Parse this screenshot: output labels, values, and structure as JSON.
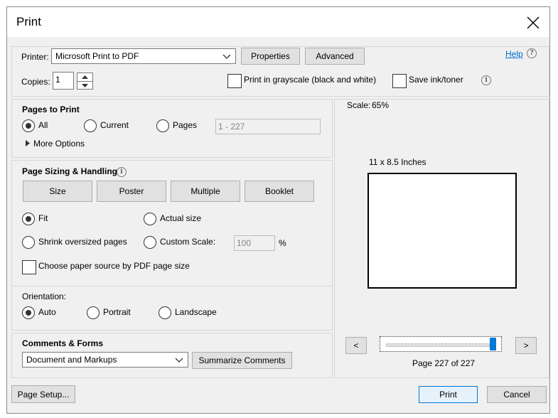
{
  "dialog": {
    "title": "Print",
    "close_icon": "close-icon"
  },
  "printer": {
    "label": "Printer:",
    "selected": "Microsoft Print to PDF",
    "properties_label": "Properties",
    "advanced_label": "Advanced",
    "help_label": "Help"
  },
  "copies": {
    "label": "Copies:",
    "value": "1"
  },
  "options": {
    "grayscale_label": "Print in grayscale (black and white)",
    "save_ink_label": "Save ink/toner"
  },
  "pages_to_print": {
    "heading": "Pages to Print",
    "all_label": "All",
    "current_label": "Current",
    "pages_label": "Pages",
    "pages_range_value": "1 - 227",
    "more_options_label": "More Options",
    "selected": "All"
  },
  "page_sizing": {
    "heading": "Page Sizing & Handling",
    "tabs": [
      "Size",
      "Poster",
      "Multiple",
      "Booklet"
    ],
    "fit_label": "Fit",
    "actual_size_label": "Actual size",
    "shrink_label": "Shrink oversized pages",
    "custom_scale_label": "Custom Scale:",
    "custom_scale_value": "100",
    "percent_label": "%",
    "paper_source_label": "Choose paper source by PDF page size",
    "selected": "Fit"
  },
  "orientation": {
    "heading": "Orientation:",
    "auto_label": "Auto",
    "portrait_label": "Portrait",
    "landscape_label": "Landscape",
    "selected": "Auto"
  },
  "comments": {
    "heading": "Comments & Forms",
    "selected": "Document and Markups",
    "summarize_label": "Summarize Comments"
  },
  "preview": {
    "scale_label": "Scale:",
    "scale_value": "65%",
    "page_size_label": "11 x 8.5 Inches",
    "prev_label": "<",
    "next_label": ">",
    "page_indicator": "Page 227 of 227",
    "slider_fraction": 1.0
  },
  "footer": {
    "page_setup_label": "Page Setup...",
    "print_label": "Print",
    "cancel_label": "Cancel"
  },
  "colors": {
    "accent": "#0078d7",
    "link": "#0066cc"
  }
}
